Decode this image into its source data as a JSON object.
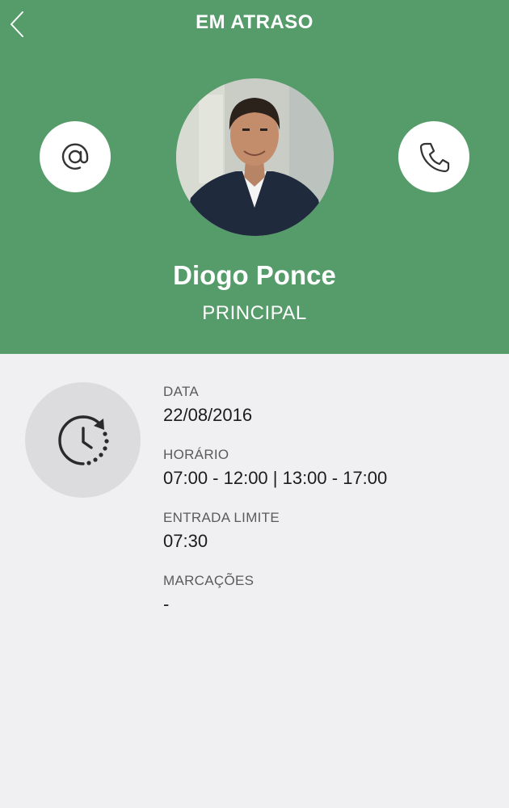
{
  "header": {
    "title": "EM ATRASO",
    "back_icon": "chevron-left-icon",
    "bg_color": "#559c6a"
  },
  "contact": {
    "email_icon": "at-sign-icon",
    "phone_icon": "phone-icon"
  },
  "profile": {
    "name": "Diogo Ponce",
    "role": "PRINCIPAL"
  },
  "details": {
    "icon": "clock-history-icon",
    "fields": [
      {
        "label": "DATA",
        "value": "22/08/2016"
      },
      {
        "label": "HORÁRIO",
        "value": "07:00 - 12:00 | 13:00 - 17:00"
      },
      {
        "label": "ENTRADA LIMITE",
        "value": "07:30"
      },
      {
        "label": "MARCAÇÕES",
        "value": "-"
      }
    ]
  }
}
